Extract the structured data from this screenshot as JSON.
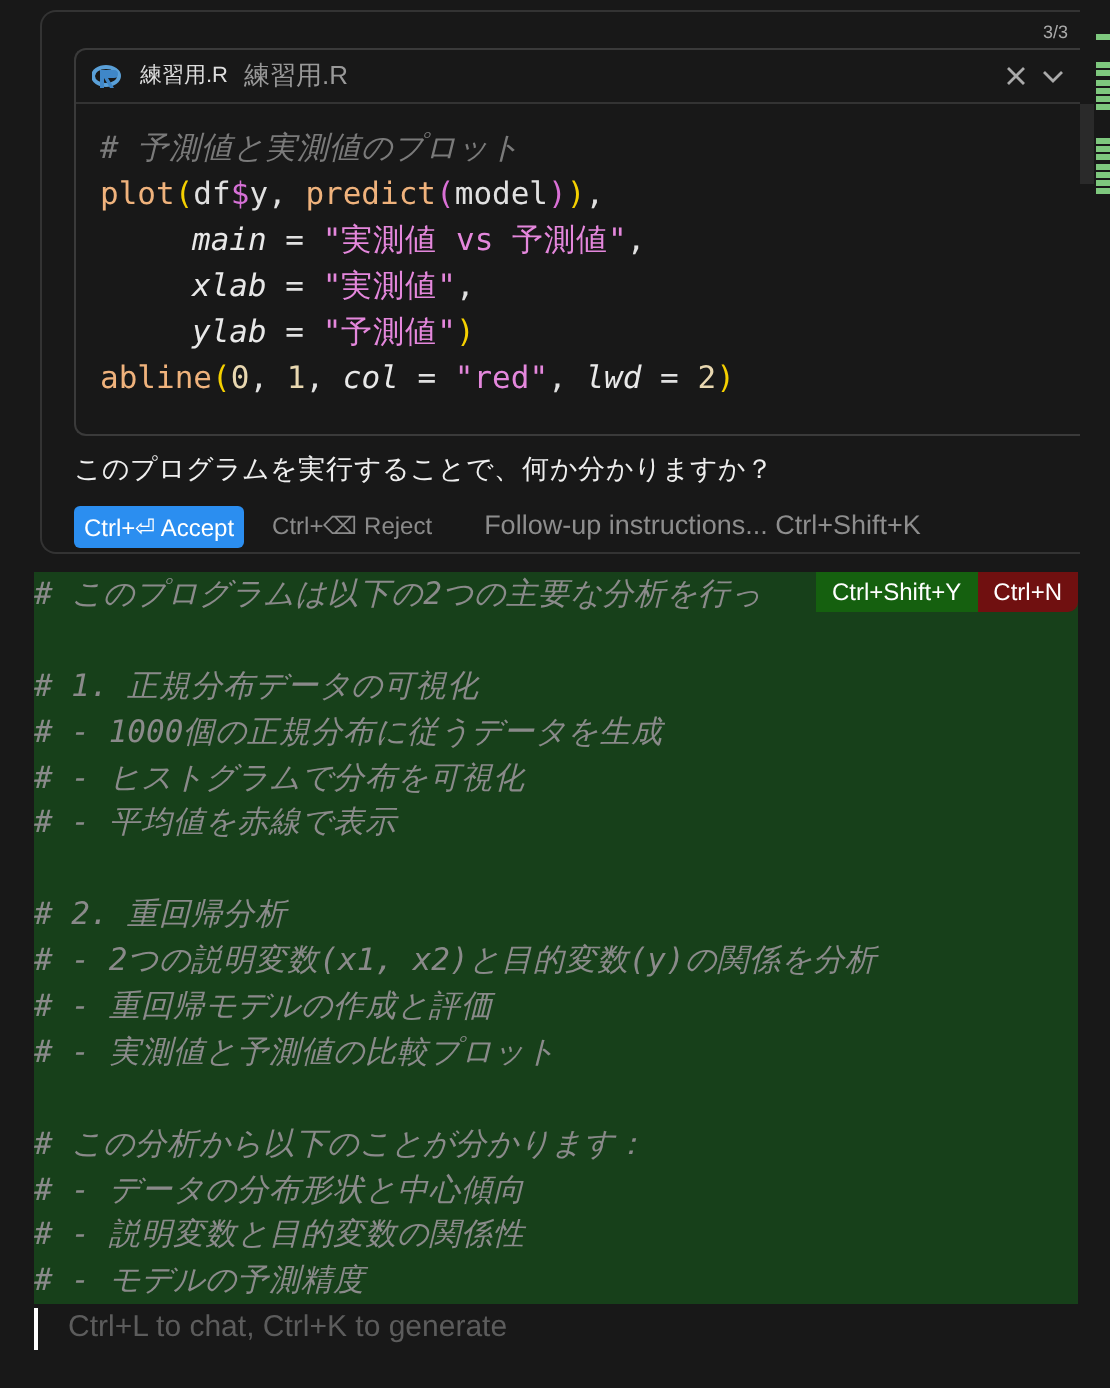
{
  "counter": "3/3",
  "file_tab": {
    "title": "練習用.R",
    "path": "練習用.R"
  },
  "code_lines": [
    {
      "indent": false,
      "tokens": [
        {
          "kind": "comment",
          "text": "# 予測値と実測値のプロット"
        }
      ]
    },
    {
      "indent": false,
      "tokens": [
        {
          "kind": "func",
          "text": "plot"
        },
        {
          "kind": "paren1",
          "text": "("
        },
        {
          "kind": "text",
          "text": "df"
        },
        {
          "kind": "dollar",
          "text": "$"
        },
        {
          "kind": "text",
          "text": "y, "
        },
        {
          "kind": "func",
          "text": "predict"
        },
        {
          "kind": "paren2",
          "text": "("
        },
        {
          "kind": "text",
          "text": "model"
        },
        {
          "kind": "paren2",
          "text": ")"
        },
        {
          "kind": "paren1",
          "text": ")"
        },
        {
          "kind": "text",
          "text": ","
        }
      ]
    },
    {
      "indent": true,
      "tokens": [
        {
          "kind": "param",
          "text": "main"
        },
        {
          "kind": "text",
          "text": " = "
        },
        {
          "kind": "string",
          "text": "\"実測値 vs 予測値\""
        },
        {
          "kind": "text",
          "text": ","
        }
      ]
    },
    {
      "indent": true,
      "tokens": [
        {
          "kind": "param",
          "text": "xlab"
        },
        {
          "kind": "text",
          "text": " = "
        },
        {
          "kind": "string",
          "text": "\"実測値\""
        },
        {
          "kind": "text",
          "text": ","
        }
      ]
    },
    {
      "indent": true,
      "tokens": [
        {
          "kind": "param",
          "text": "ylab"
        },
        {
          "kind": "text",
          "text": " = "
        },
        {
          "kind": "string",
          "text": "\"予測値\""
        },
        {
          "kind": "paren1",
          "text": ")"
        }
      ]
    },
    {
      "indent": false,
      "tokens": [
        {
          "kind": "func",
          "text": "abline"
        },
        {
          "kind": "paren1",
          "text": "("
        },
        {
          "kind": "number",
          "text": "0"
        },
        {
          "kind": "text",
          "text": ", "
        },
        {
          "kind": "number",
          "text": "1"
        },
        {
          "kind": "text",
          "text": ", "
        },
        {
          "kind": "param",
          "text": "col"
        },
        {
          "kind": "text",
          "text": " = "
        },
        {
          "kind": "string",
          "text": "\"red\""
        },
        {
          "kind": "text",
          "text": ", "
        },
        {
          "kind": "param",
          "text": "lwd"
        },
        {
          "kind": "text",
          "text": " = "
        },
        {
          "kind": "number",
          "text": "2"
        },
        {
          "kind": "paren1",
          "text": ")"
        }
      ]
    }
  ],
  "question": "このプログラムを実行することで、何か分かりますか？",
  "actions": [
    {
      "kind": "primary",
      "label": "Ctrl+⏎ Accept"
    },
    {
      "kind": "secondary",
      "label": "Ctrl+⌫ Reject"
    }
  ],
  "followup": {
    "placeholder": "Follow-up instructions... Ctrl+Shift+K"
  },
  "shortcut_badges": [
    {
      "kind": "accept",
      "label": "Ctrl+Shift+Y"
    },
    {
      "kind": "reject",
      "label": "Ctrl+N"
    }
  ],
  "diff_lines": [
    {
      "kind": "comment",
      "text": "# このプログラムは以下の2つの主要な分析を行っ"
    },
    {
      "kind": "blank"
    },
    {
      "kind": "comment",
      "text": "# 1. 正規分布データの可視化"
    },
    {
      "kind": "comment",
      "text": "# - 1000個の正規分布に従うデータを生成"
    },
    {
      "kind": "comment",
      "text": "# - ヒストグラムで分布を可視化"
    },
    {
      "kind": "comment",
      "text": "# - 平均値を赤線で表示"
    },
    {
      "kind": "blank"
    },
    {
      "kind": "comment",
      "text": "# 2. 重回帰分析"
    },
    {
      "kind": "comment",
      "text": "# - 2つの説明変数(x1, x2)と目的変数(y)の関係を分析"
    },
    {
      "kind": "comment",
      "text": "# - 重回帰モデルの作成と評価"
    },
    {
      "kind": "comment",
      "text": "# - 実測値と予測値の比較プロット"
    },
    {
      "kind": "blank"
    },
    {
      "kind": "comment",
      "text": "# この分析から以下のことが分かります："
    },
    {
      "kind": "comment",
      "text": "# - データの分布形状と中心傾向"
    },
    {
      "kind": "comment",
      "text": "# - 説明変数と目的変数の関係性"
    },
    {
      "kind": "comment",
      "text": "# - モデルの予測精度"
    }
  ],
  "editor_hint": "Ctrl+L to chat, Ctrl+K to generate"
}
